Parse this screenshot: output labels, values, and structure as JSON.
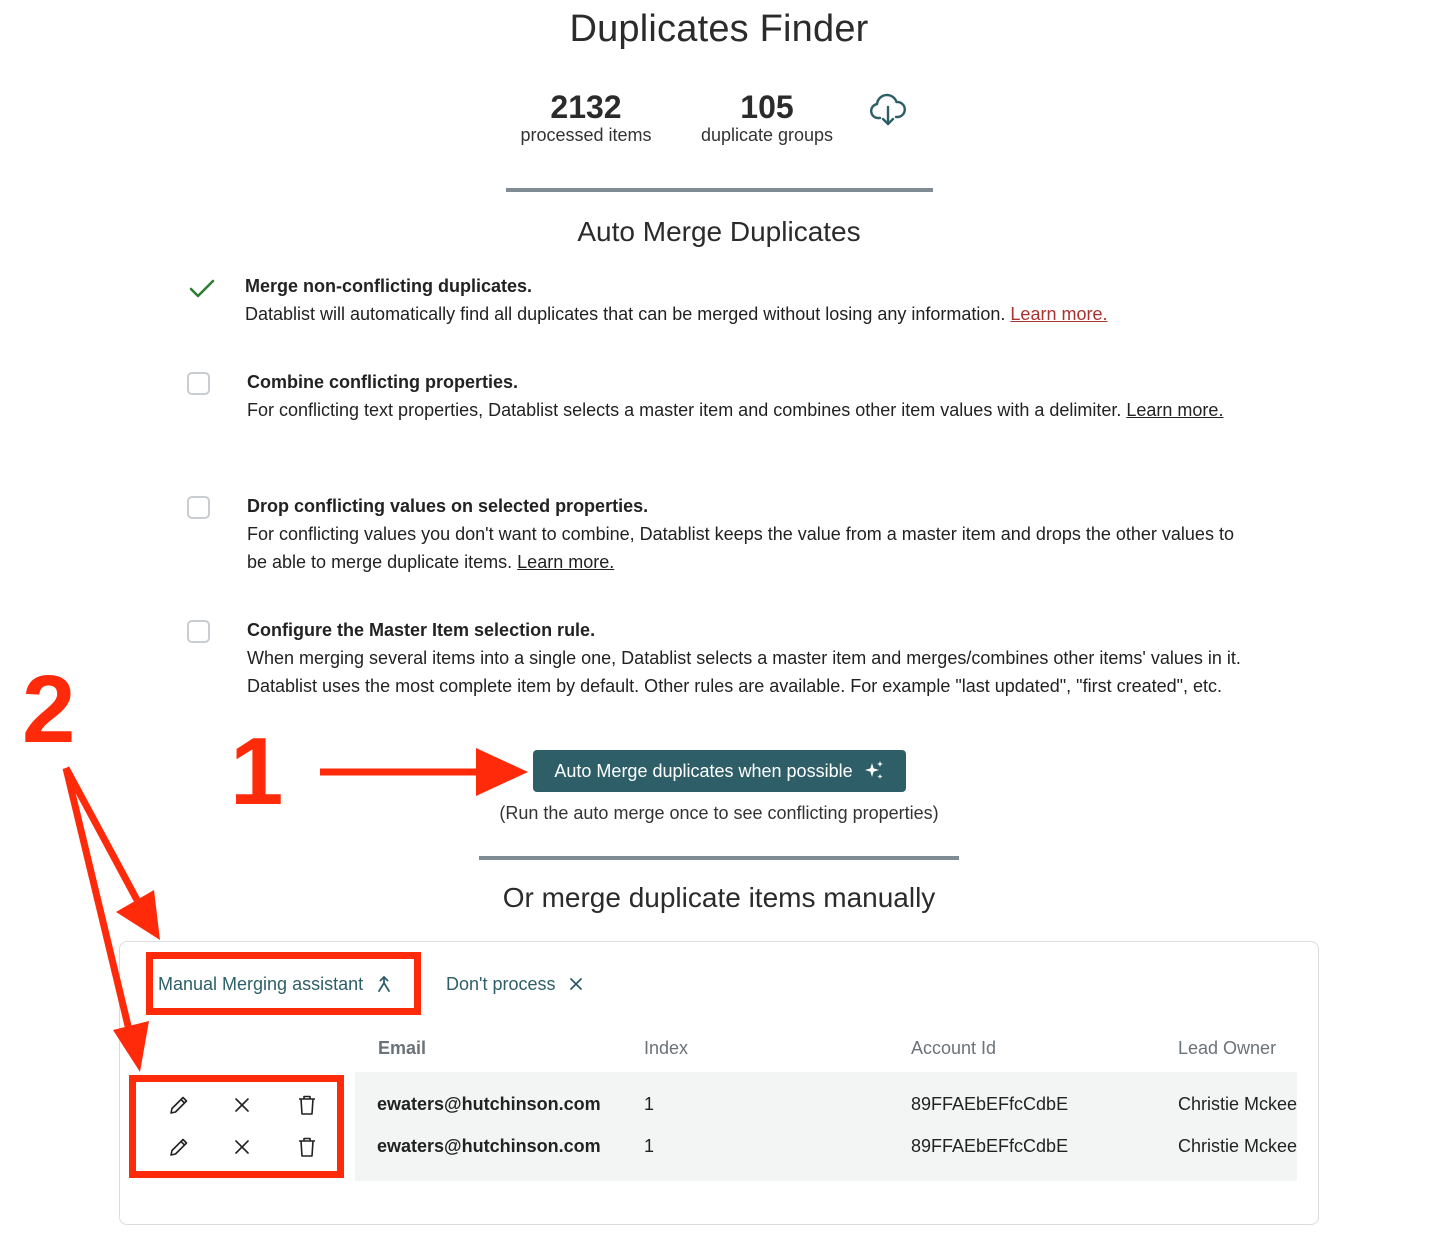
{
  "header": {
    "title": "Duplicates Finder",
    "stats": [
      {
        "value": "2132",
        "label": "processed items"
      },
      {
        "value": "105",
        "label": "duplicate groups"
      }
    ],
    "download_icon": "cloud-download-icon"
  },
  "auto_merge": {
    "title": "Auto Merge Duplicates",
    "options": [
      {
        "title": "Merge non-conflicting duplicates.",
        "desc": "Datablist will automatically find all duplicates that can be merged without losing any information.",
        "link": "Learn more.",
        "state": "done"
      },
      {
        "title": "Combine conflicting properties.",
        "desc": "For conflicting text properties, Datablist selects a master item and combines other item values with a delimiter.",
        "link": "Learn more.",
        "state": "unchecked"
      },
      {
        "title": "Drop conflicting values on selected properties.",
        "desc": "For conflicting values you don't want to combine, Datablist keeps the value from a master item and drops the other values to be able to merge duplicate items.",
        "link": "Learn more.",
        "state": "unchecked"
      },
      {
        "title": "Configure the Master Item selection rule.",
        "desc": "When merging several items into a single one, Datablist selects a master item and merges/combines other items' values in it. Datablist uses the most complete item by default. Other rules are available. For example \"last updated\", \"first created\", etc.",
        "state": "unchecked"
      }
    ],
    "button_label": "Auto Merge duplicates when possible",
    "hint": "(Run the auto merge once to see conflicting properties)"
  },
  "manual": {
    "title": "Or merge duplicate items manually",
    "tabs": [
      {
        "label": "Manual Merging assistant",
        "icon": "merge-icon"
      },
      {
        "label": "Don't process",
        "icon": "close-icon"
      }
    ],
    "columns": [
      "Email",
      "Index",
      "Account Id",
      "Lead Owner"
    ],
    "rows": [
      [
        "ewaters@hutchinson.com",
        "1",
        "89FFAEbEFfcCdbE",
        "Christie Mckee"
      ],
      [
        "ewaters@hutchinson.com",
        "1",
        "89FFAEbEFfcCdbE",
        "Christie Mckee"
      ]
    ],
    "row_actions": [
      "pencil-icon",
      "close-icon",
      "trash-icon"
    ]
  },
  "annotations": {
    "one": "1",
    "two": "2"
  },
  "colors": {
    "primary": "#2e5f68",
    "annotation": "#ff2a0a",
    "check": "#2e7d32",
    "link_red": "#a83232"
  }
}
